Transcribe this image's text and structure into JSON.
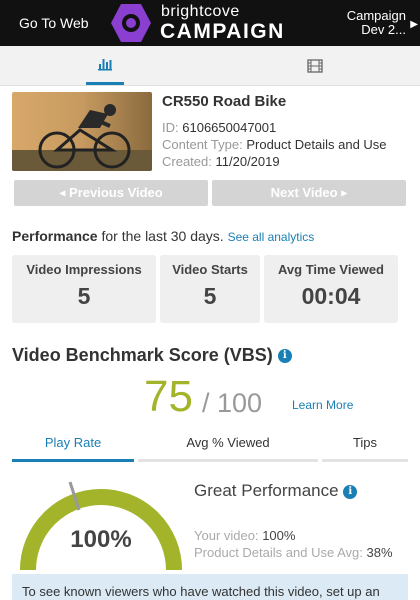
{
  "header": {
    "go_to_web": "Go To Web",
    "logo_small": "brightcove",
    "logo_big": "CAMPAIGN",
    "campaign_line1": "Campaign",
    "campaign_line2": "Dev 2..."
  },
  "video": {
    "title": "CR550 Road Bike",
    "id_label": "ID:",
    "id_value": "6106650047001",
    "content_type_label": "Content Type:",
    "content_type_value": "Product Details and Use",
    "created_label": "Created:",
    "created_value": "11/20/2019"
  },
  "nav": {
    "previous": "Previous Video",
    "next": "Next Video"
  },
  "performance": {
    "bold": "Performance",
    "text": "for the last 30 days.",
    "link": "See all analytics",
    "stats": [
      {
        "label": "Video Impressions",
        "value": "5"
      },
      {
        "label": "Video Starts",
        "value": "5"
      },
      {
        "label": "Avg Time Viewed",
        "value": "00:04"
      }
    ]
  },
  "vbs": {
    "title": "Video Benchmark Score (VBS)",
    "score": "75",
    "out_of": "/ 100",
    "learn_more": "Learn More",
    "tabs": [
      "Play Rate",
      "Avg % Viewed",
      "Tips"
    ],
    "gauge_value": "100%",
    "gauge_fraction": 1.0,
    "rating": "Great Performance",
    "your_label": "Your video:",
    "your_value": "100%",
    "avg_label": "Product Details and Use Avg:",
    "avg_value": "38%"
  },
  "notice": {
    "text": "To see known viewers who have watched this video, set up an"
  },
  "colors": {
    "accent": "#1a7fb5",
    "score": "#a3b42a",
    "logo": "#8a3fd1"
  }
}
